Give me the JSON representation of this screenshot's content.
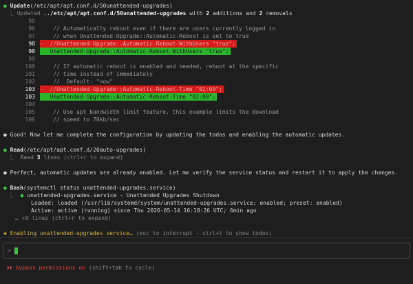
{
  "update_block": {
    "bullet": "●",
    "tool": "Update",
    "arg": "(/etc/apt/apt.conf.d/50unattended-upgrades)",
    "summary_prefix": "⎿ Updated ",
    "summary_path": "../etc/apt/apt.conf.d/50unattended-upgrades",
    "summary_mid1": " with ",
    "summary_add_count": "2",
    "summary_mid2": " additions and ",
    "summary_del_count": "2",
    "summary_end": " removals",
    "diff": [
      {
        "ln": "95",
        "type": "ctx",
        "text": ""
      },
      {
        "ln": "96",
        "type": "ctx",
        "text": "    // Automatically reboot even if there are users currently logged in"
      },
      {
        "ln": "97",
        "type": "ctx",
        "text": "    // when Unattended-Upgrade::Automatic-Reboot is set to true"
      },
      {
        "ln": "98",
        "type": "del",
        "text": "-  //Unattended-Upgrade::Automatic-Reboot-WithUsers \"true\";"
      },
      {
        "ln": "98",
        "type": "add",
        "text": "   Unattended-Upgrade::Automatic-Reboot-WithUsers \"true\";"
      },
      {
        "ln": "99",
        "type": "ctx",
        "text": ""
      },
      {
        "ln": "100",
        "type": "ctx",
        "text": "    // If automatic reboot is enabled and needed, reboot at the specific"
      },
      {
        "ln": "101",
        "type": "ctx",
        "text": "    // time instead of immediately"
      },
      {
        "ln": "102",
        "type": "ctx",
        "text": "    //  Default: \"now\""
      },
      {
        "ln": "103",
        "type": "del",
        "text": "-  //Unattended-Upgrade::Automatic-Reboot-Time \"02:00\";"
      },
      {
        "ln": "103",
        "type": "add",
        "text": "   Unattended-Upgrade::Automatic-Reboot-Time \"02:00\";"
      },
      {
        "ln": "104",
        "type": "ctx",
        "text": ""
      },
      {
        "ln": "105",
        "type": "ctx",
        "text": "    // Use apt bandwidth limit feature, this example limits the download"
      },
      {
        "ln": "106",
        "type": "ctx",
        "text": "    // speed to 70kb/sec"
      }
    ]
  },
  "msg1": {
    "bullet": "●",
    "text": " Good! Now let me complete the configuration by updating the todos and enabling the automatic updates."
  },
  "read_block": {
    "bullet": "●",
    "tool": "Read",
    "arg": "(/etc/apt/apt.conf.d/20auto-upgrades)",
    "line_prefix": "⎿  Read ",
    "count": "3",
    "line_suffix": " lines (ctrl+r to expand)"
  },
  "msg2": {
    "bullet": "●",
    "text": " Perfect, automatic updates are already enabled. Let me verify the service status and restart it to apply the changes."
  },
  "bash_block": {
    "bullet": "●",
    "tool": "Bash",
    "arg": "(systemctl status unattended-upgrades.service)",
    "out1_prefix": "⎿  ",
    "out1_dot": "●",
    "out1": " unattended-upgrades.service - Unattended Upgrades Shutdown",
    "out2": "Loaded: loaded (/usr/lib/systemd/system/unattended-upgrades.service; enabled; preset: enabled)",
    "out3": "Active: active (running) since Thu 2026-05-14 16:18:26 UTC; 6min ago",
    "more": "… +9 lines (ctrl+r to expand)"
  },
  "activity": {
    "spinner": "✱",
    "text": " Enabling unattended-upgrades service…",
    "hint": " (esc to interrupt · ctrl+t to show todos)"
  },
  "input": {
    "prompt": ">",
    "value": ""
  },
  "footer": {
    "icon": "⏵⏵",
    "mode": " bypass permissions on",
    "hint": " (shift+tab to cycle)"
  },
  "colors": {
    "accent": "#3ec43e",
    "deletion": "#d61a1a",
    "addition": "#2bb52b",
    "warning": "#e0483e"
  }
}
